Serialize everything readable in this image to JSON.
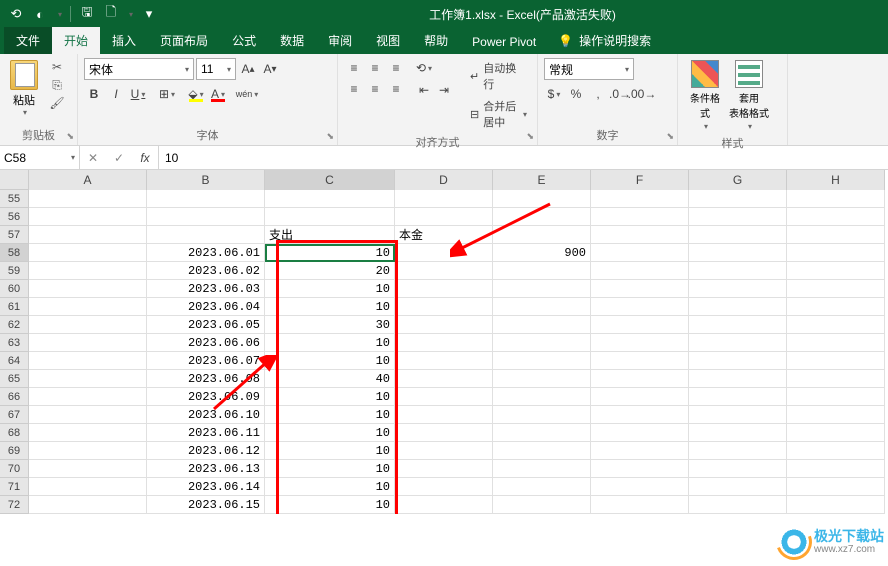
{
  "title": "工作簿1.xlsx - Excel(产品激活失败)",
  "menu": {
    "file": "文件",
    "home": "开始",
    "insert": "插入",
    "layout": "页面布局",
    "formulas": "公式",
    "data": "数据",
    "review": "审阅",
    "view": "视图",
    "help": "帮助",
    "powerpivot": "Power Pivot",
    "tellme": "操作说明搜索"
  },
  "ribbon": {
    "clipboard": {
      "label": "剪贴板",
      "paste": "粘贴"
    },
    "font": {
      "label": "字体",
      "name": "宋体",
      "size": "11"
    },
    "align": {
      "label": "对齐方式",
      "wrap": "自动换行",
      "merge": "合并后居中"
    },
    "number": {
      "label": "数字",
      "format": "常规"
    },
    "styles": {
      "label": "样式",
      "cond": "条件格式",
      "table": "套用\n表格格式"
    }
  },
  "formula_bar": {
    "name_box": "C58",
    "value": "10"
  },
  "columns": [
    "A",
    "B",
    "C",
    "D",
    "E",
    "F",
    "G",
    "H"
  ],
  "row_start": 55,
  "headers": {
    "c": "支出",
    "d": "本金"
  },
  "principal": "900",
  "rows": [
    {
      "date": "2023.06.01",
      "out": "10"
    },
    {
      "date": "2023.06.02",
      "out": "20"
    },
    {
      "date": "2023.06.03",
      "out": "10"
    },
    {
      "date": "2023.06.04",
      "out": "10"
    },
    {
      "date": "2023.06.05",
      "out": "30"
    },
    {
      "date": "2023.06.06",
      "out": "10"
    },
    {
      "date": "2023.06.07",
      "out": "10"
    },
    {
      "date": "2023.06.08",
      "out": "40"
    },
    {
      "date": "2023.06.09",
      "out": "10"
    },
    {
      "date": "2023.06.10",
      "out": "10"
    },
    {
      "date": "2023.06.11",
      "out": "10"
    },
    {
      "date": "2023.06.12",
      "out": "10"
    },
    {
      "date": "2023.06.13",
      "out": "10"
    },
    {
      "date": "2023.06.14",
      "out": "10"
    },
    {
      "date": "2023.06.15",
      "out": "10"
    }
  ],
  "watermark": {
    "cn": "极光下载站",
    "url": "www.xz7.com"
  }
}
